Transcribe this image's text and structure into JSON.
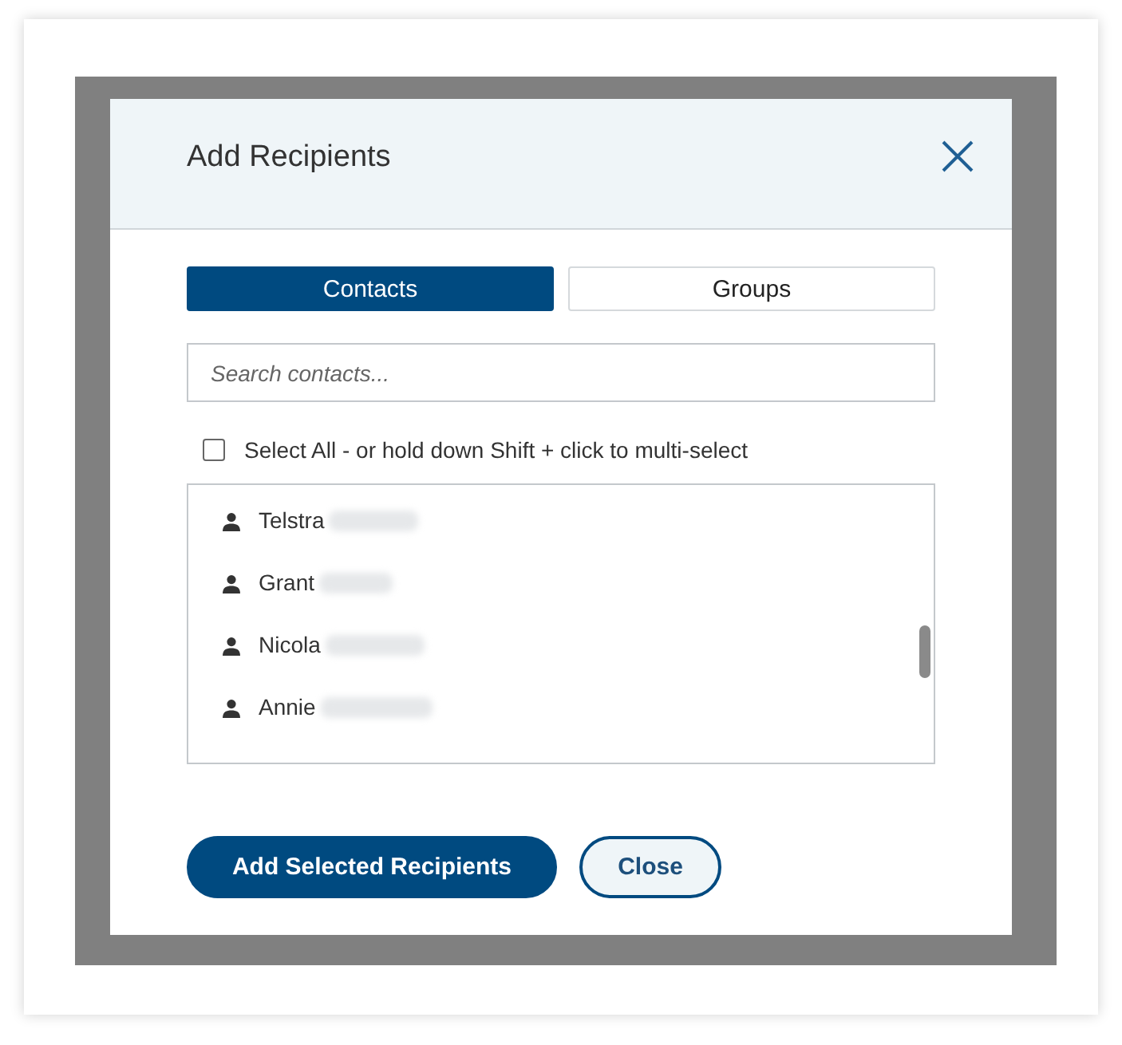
{
  "dialog": {
    "title": "Add Recipients",
    "tabs": [
      {
        "label": "Contacts",
        "selected": true
      },
      {
        "label": "Groups",
        "selected": false
      }
    ],
    "search": {
      "placeholder": "Search contacts..."
    },
    "select_all": {
      "label": "Select All - or hold down Shift + click to multi-select",
      "checked": false
    },
    "contacts": [
      {
        "first_name": "Telstra"
      },
      {
        "first_name": "Grant"
      },
      {
        "first_name": "Nicola"
      },
      {
        "first_name": "Annie"
      }
    ],
    "buttons": [
      {
        "label": "Add Selected Recipients",
        "kind": "primary"
      },
      {
        "label": "Close",
        "kind": "secondary"
      }
    ]
  }
}
